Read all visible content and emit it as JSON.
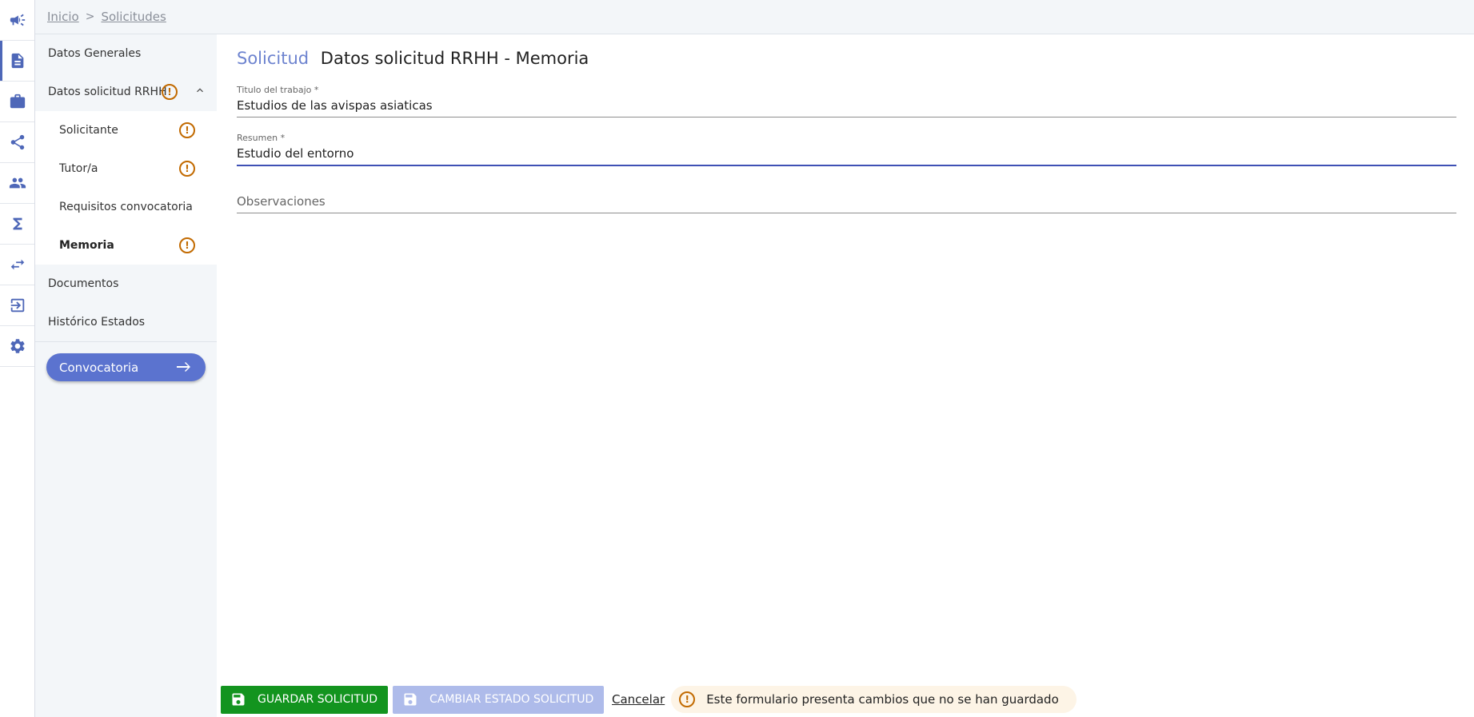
{
  "breadcrumb": {
    "home": "Inicio",
    "separator": ">",
    "current": "Solicitudes"
  },
  "rail": {
    "icons": [
      "megaphone-icon",
      "document-icon",
      "briefcase-icon",
      "share-icon",
      "people-icon",
      "sigma-icon",
      "swap-icon",
      "logout-icon",
      "gear-icon"
    ],
    "active_index": 1
  },
  "sidenav": {
    "datos_generales": "Datos Generales",
    "datos_solicitud": "Datos solicitud RRHH",
    "solicitante": "Solicitante",
    "tutor": "Tutor/a",
    "requisitos": "Requisitos convocatoria",
    "memoria": "Memoria",
    "documentos": "Documentos",
    "historico": "Histórico Estados",
    "warning_glyph": "!",
    "convocatoria_button": "Convocatoria"
  },
  "main": {
    "heading_prefix": "Solicitud",
    "heading_title": "Datos solicitud RRHH - Memoria",
    "titulo_label": "Titulo del trabajo *",
    "titulo_value": "Estudios de las avispas asiaticas",
    "resumen_label": "Resumen *",
    "resumen_value": "Estudio del entorno",
    "observaciones_placeholder": "Observaciones"
  },
  "footer": {
    "save_label": "GUARDAR SOLICITUD",
    "change_state_label": "CAMBIAR ESTADO SOLICITUD",
    "cancel_label": "Cancelar",
    "unsaved_message": "Este formulario presenta cambios que no se han guardado"
  },
  "colors": {
    "accent": "#4e67b8",
    "save_green": "#13941f",
    "warning": "#c26a00",
    "disabled_button": "#aebbea"
  }
}
